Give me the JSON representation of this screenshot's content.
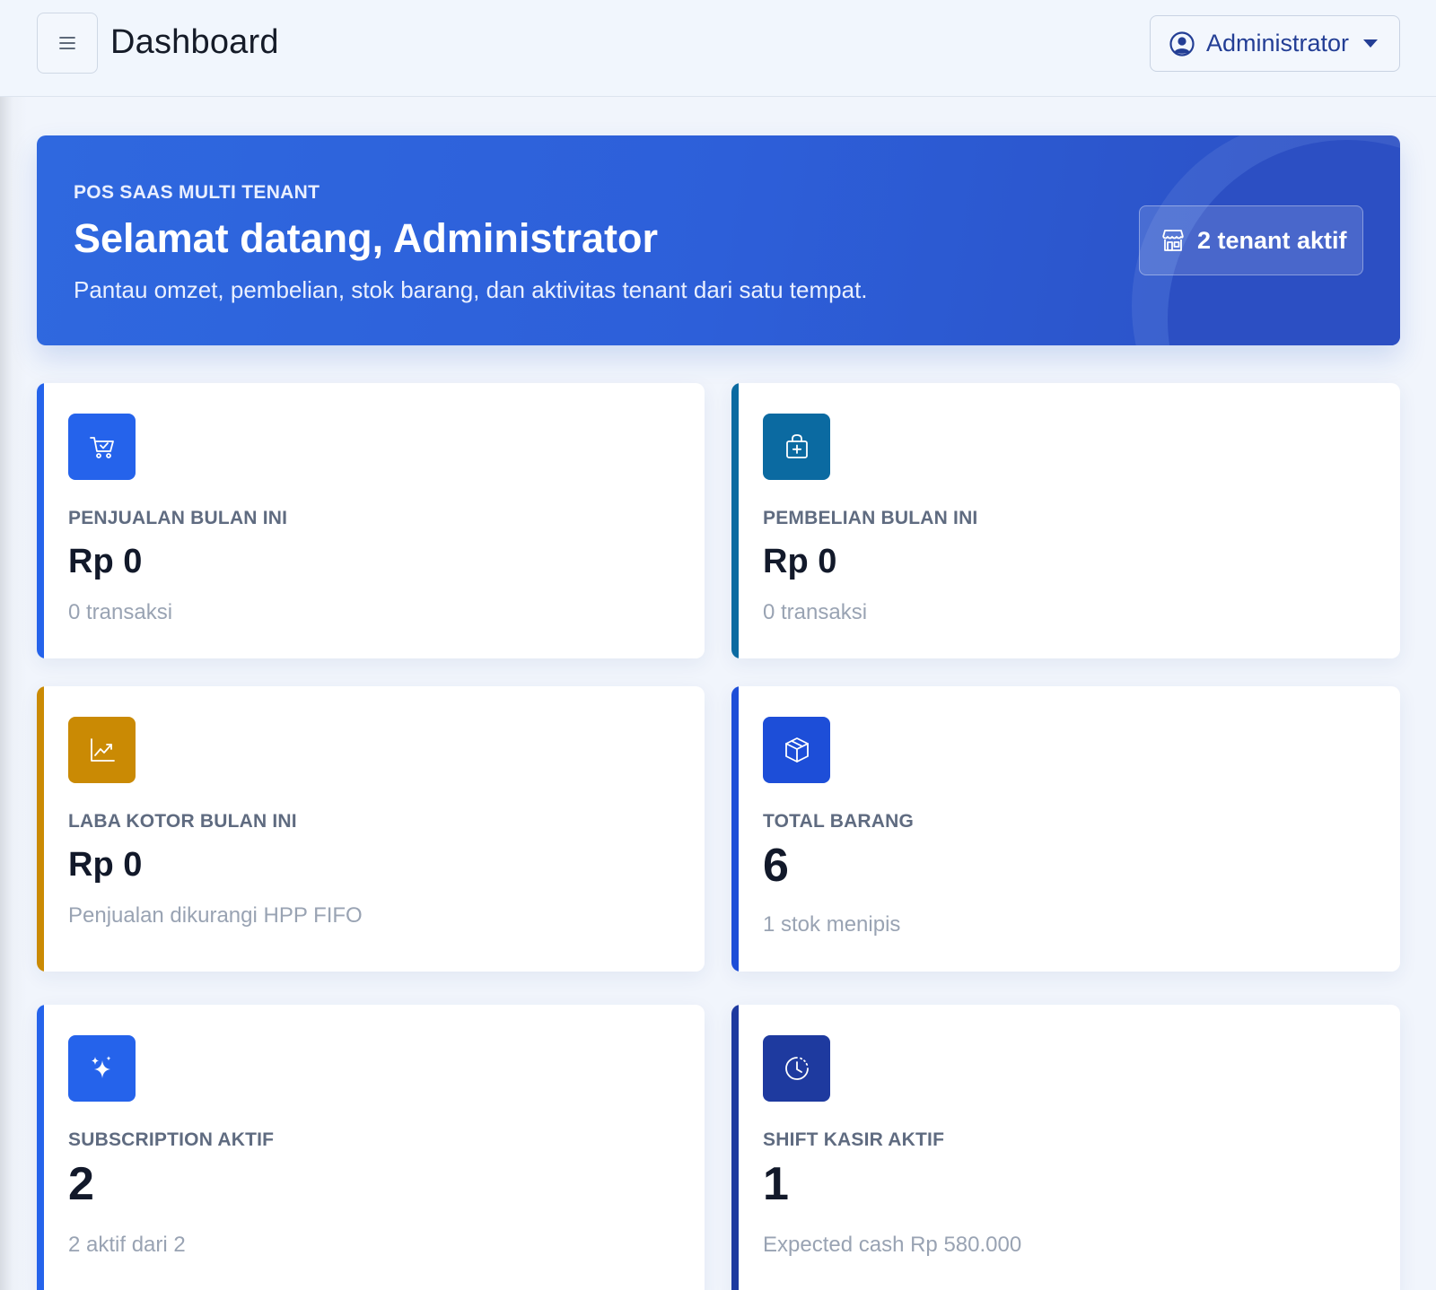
{
  "header": {
    "title": "Dashboard",
    "menu_icon": "hamburger-menu-icon",
    "user": {
      "name": "Administrator",
      "icon": "user-circle-icon"
    }
  },
  "hero": {
    "eyebrow": "POS SAAS MULTI TENANT",
    "title": "Selamat datang, Administrator",
    "subtitle": "Pantau omzet, pembelian, stok barang, dan aktivitas tenant dari satu tempat.",
    "badge": {
      "label": "2 tenant aktif",
      "icon": "store-icon"
    }
  },
  "cards": [
    {
      "label": "PENJUALAN BULAN INI",
      "value": "Rp 0",
      "note": "0 transaksi",
      "icon": "cart-check-icon",
      "color": "#2563eb"
    },
    {
      "label": "PEMBELIAN BULAN INI",
      "value": "Rp 0",
      "note": "0 transaksi",
      "icon": "shopping-bag-plus-icon",
      "color": "#0b6aa1"
    },
    {
      "label": "LABA KOTOR BULAN INI",
      "value": "Rp 0",
      "note": "Penjualan dikurangi HPP FIFO",
      "icon": "chart-line-up-icon",
      "color": "#ca8a04"
    },
    {
      "label": "TOTAL BARANG",
      "value": "6",
      "note": "1 stok menipis",
      "icon": "box-icon",
      "color": "#1d4ed8"
    },
    {
      "label": "SUBSCRIPTION AKTIF",
      "value": "2",
      "note": "2 aktif dari 2",
      "icon": "sparkles-icon",
      "color": "#2563eb"
    },
    {
      "label": "SHIFT KASIR AKTIF",
      "value": "1",
      "note": "Expected cash Rp 580.000",
      "icon": "clock-history-icon",
      "color": "#1e3a9f"
    }
  ]
}
